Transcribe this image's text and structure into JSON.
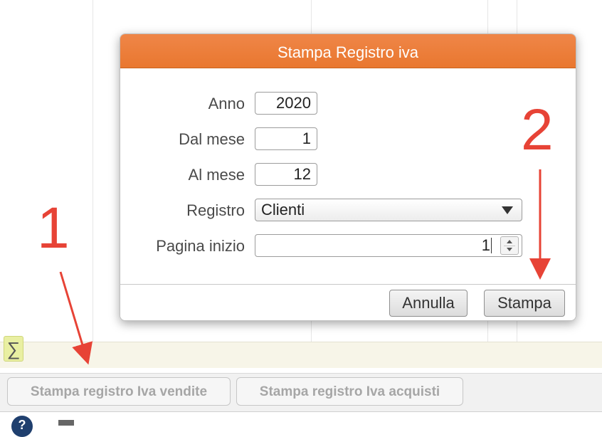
{
  "dialog": {
    "title": "Stampa Registro iva",
    "fields": {
      "anno": {
        "label": "Anno",
        "value": "2020"
      },
      "dal_mese": {
        "label": "Dal mese",
        "value": "1"
      },
      "al_mese": {
        "label": "Al mese",
        "value": "12"
      },
      "registro": {
        "label": "Registro",
        "value": "Clienti"
      },
      "pagina_inizio": {
        "label": "Pagina inizio",
        "value": "1"
      }
    },
    "buttons": {
      "cancel": "Annulla",
      "print": "Stampa"
    }
  },
  "toolbar": {
    "sigma": "∑"
  },
  "footer": {
    "btn_vendite": "Stampa registro Iva vendite",
    "btn_acquisti": "Stampa registro Iva acquisti"
  },
  "status": {
    "help_glyph": "?"
  },
  "annotations": {
    "step1": "1",
    "step2": "2"
  },
  "colors": {
    "accent": "#ea7a35",
    "annotation": "#e74336"
  }
}
